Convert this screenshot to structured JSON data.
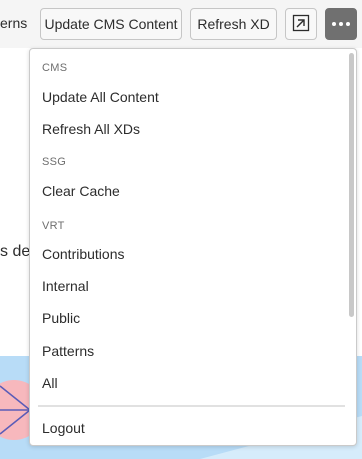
{
  "toolbar": {
    "nav_cut_text": "erns",
    "update_cms_label": "Update CMS Content",
    "refresh_xd_label": "Refresh XD",
    "open_icon": "open-in-new-icon",
    "more_icon": "more-icon"
  },
  "background": {
    "text": "s des"
  },
  "menu": {
    "sections": {
      "cms": "CMS",
      "ssg": "SSG",
      "vrt": "VRT"
    },
    "items": {
      "update_all_content": "Update All Content",
      "refresh_all_xds": "Refresh All XDs",
      "clear_cache": "Clear Cache",
      "contributions": "Contributions",
      "internal": "Internal",
      "public": "Public",
      "patterns": "Patterns",
      "all": "All",
      "logout": "Logout"
    }
  },
  "colors": {
    "more_button_bg": "#707070",
    "illustration_blue": "#b8dcf7",
    "illustration_pink": "#f7b8bd",
    "illustration_line": "#5a5cb8"
  }
}
